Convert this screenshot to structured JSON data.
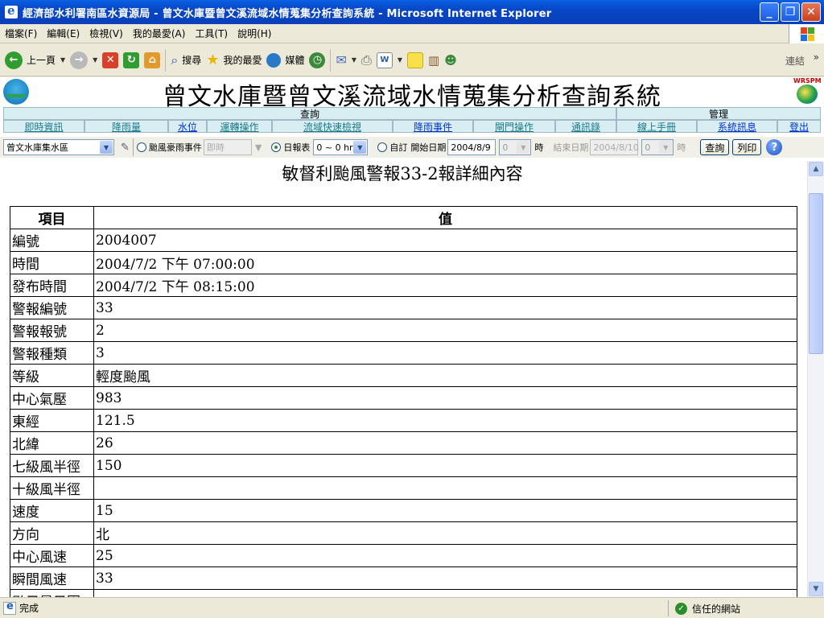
{
  "window": {
    "title": "經濟部水利署南區水資源局 - 曾文水庫暨曾文溪流域水情蒐集分析查詢系統 - Microsoft Internet Explorer"
  },
  "menubar": [
    "檔案(F)",
    "編輯(E)",
    "檢視(V)",
    "我的最愛(A)",
    "工具(T)",
    "說明(H)"
  ],
  "toolbar": {
    "back": "上一頁",
    "search": "搜尋",
    "favorites": "我的最愛",
    "media": "媒體",
    "links": "連結"
  },
  "site": {
    "title": "曾文水庫暨曾文溪流域水情蒐集分析查詢系統",
    "logo_right": "WRSPM"
  },
  "nav": {
    "query_header": "查詢",
    "admin_header": "管理",
    "items": [
      "即時資訊",
      "降雨量",
      "水位",
      "運轉操作",
      "流域快速檢視",
      "降雨事件",
      "閘門操作",
      "通訊錄",
      "線上手冊",
      "系統訊息",
      "登出"
    ]
  },
  "filter": {
    "region": "曾文水庫集水區",
    "typhoon_label": "颱風豪雨事件",
    "typhoon_value": "即時",
    "daily_label": "日報表",
    "daily_range": "0 ~ 0 hr",
    "custom_label": "自訂",
    "start_label": "開始日期",
    "start_date": "2004/8/9",
    "start_hour": "0",
    "hour_label": "時",
    "end_label": "結束日期",
    "end_date": "2004/8/10",
    "end_hour": "0",
    "query_btn": "查詢",
    "print_btn": "列印"
  },
  "detail": {
    "title": "敏督利颱風警報33-2報詳細內容",
    "col_item": "項目",
    "col_value": "值",
    "rows": [
      {
        "k": "編號",
        "v": "2004007"
      },
      {
        "k": "時間",
        "v": "2004/7/2 下午 07:00:00"
      },
      {
        "k": "發布時間",
        "v": "2004/7/2 下午 08:15:00"
      },
      {
        "k": "警報編號",
        "v": "33"
      },
      {
        "k": "警報報號",
        "v": "2"
      },
      {
        "k": "警報種類",
        "v": "3"
      },
      {
        "k": "等級",
        "v": "輕度颱風"
      },
      {
        "k": "中心氣壓",
        "v": "983"
      },
      {
        "k": "東經",
        "v": "121.5"
      },
      {
        "k": "北緯",
        "v": "26"
      },
      {
        "k": "七級風半徑",
        "v": "150"
      },
      {
        "k": "十級風半徑",
        "v": ""
      },
      {
        "k": "速度",
        "v": "15"
      },
      {
        "k": "方向",
        "v": "北"
      },
      {
        "k": "中心風速",
        "v": "25"
      },
      {
        "k": "瞬間風速",
        "v": "33"
      },
      {
        "k": "颱風暴風圈",
        "v": ""
      }
    ]
  },
  "status": {
    "text": "完成",
    "zone": "信任的網站"
  }
}
